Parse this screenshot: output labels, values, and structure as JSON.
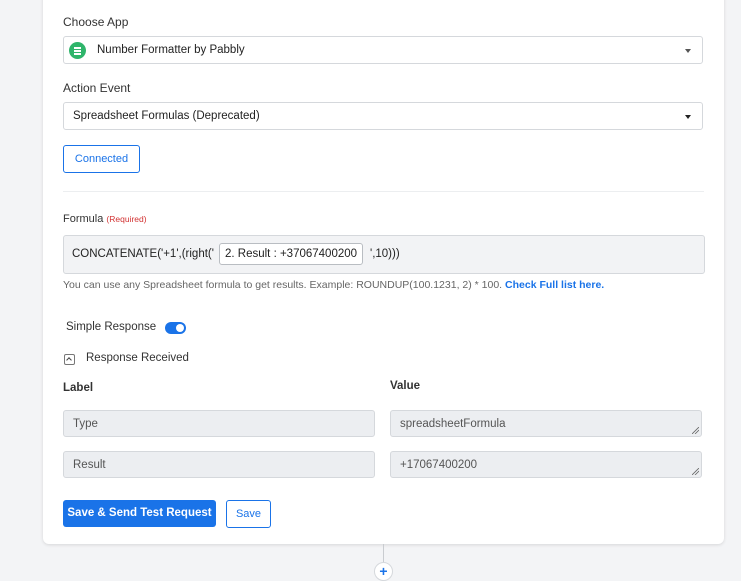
{
  "choose_app": {
    "label": "Choose App",
    "value": "Number Formatter by Pabbly",
    "icon": "list-icon",
    "icon_color": "#2fb56b"
  },
  "action_event": {
    "label": "Action Event",
    "value": "Spreadsheet Formulas (Deprecated)"
  },
  "connected_label": "Connected",
  "formula": {
    "label": "Formula",
    "required": "(Required)",
    "prefix": "CONCATENATE('+1',(right('",
    "token": "2. Result : +37067400200",
    "suffix": "',10)))"
  },
  "help": {
    "text": "You can use any Spreadsheet formula to get results. Example: ROUNDUP(100.1231, 2) * 100.",
    "link": "Check Full list here."
  },
  "simple_response": {
    "label": "Simple Response",
    "enabled": true
  },
  "response_received": {
    "label": "Response Received",
    "expanded": true
  },
  "table": {
    "label_header": "Label",
    "value_header": "Value",
    "rows": [
      {
        "label": "Type",
        "value": "spreadsheetFormula"
      },
      {
        "label": "Result",
        "value": "+17067400200"
      }
    ]
  },
  "buttons": {
    "save_send": "Save & Send Test Request",
    "save": "Save"
  },
  "add_step": "+",
  "colors": {
    "accent": "#1a73e8",
    "required": "#d23232",
    "background": "#f3f4f6"
  }
}
